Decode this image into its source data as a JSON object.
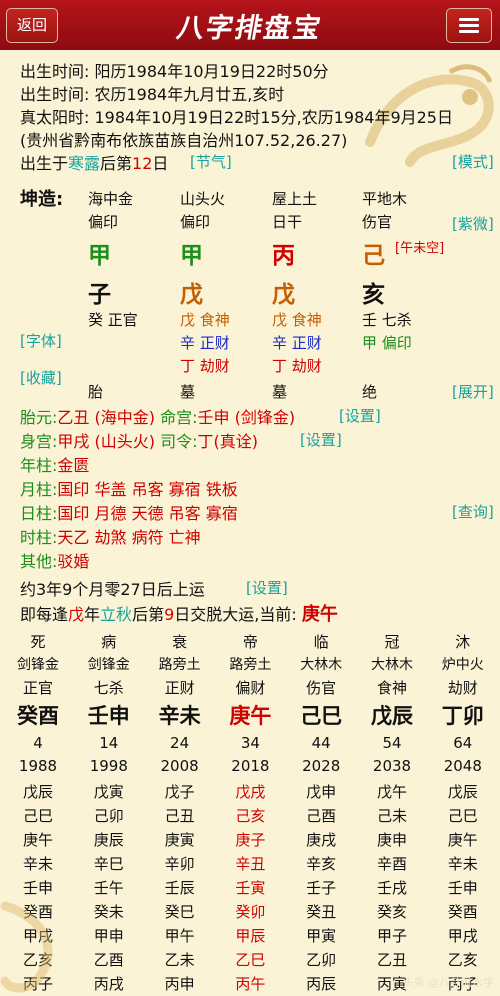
{
  "header": {
    "back_label": "返回",
    "title": "八字排盘宝"
  },
  "info": {
    "line1": "出生时间: 阳历1984年10月19日22时50分",
    "line2": "出生时间: 农历1984年九月廿五,亥时",
    "line3": "真太阳时: 1984年10月19日22时15分,农历1984年9月25日",
    "line4": "(贵州省黔南布依族苗族自治州107.52,26.27)",
    "birth_prefix": "出生于",
    "birth_term": "寒露",
    "birth_mid": "后第",
    "birth_day": "12",
    "birth_suffix": "日",
    "jieqi_link": "[节气]",
    "mode_link": "[模式]"
  },
  "chart": {
    "kunzao": "坤造:",
    "nayin": [
      "海中金",
      "山头火",
      "屋上土",
      "平地木"
    ],
    "shishen": [
      "偏印",
      "偏印",
      "日干",
      "伤官"
    ],
    "gan": [
      "甲",
      "甲",
      "丙",
      "己"
    ],
    "kongwang": "[午未空]",
    "zhi": [
      "子",
      "戊",
      "戊",
      "亥"
    ],
    "hidden": [
      [
        {
          "text": "癸 正官",
          "color": "black"
        }
      ],
      [
        {
          "text": "戊 食神",
          "color": "orange"
        },
        {
          "text": "辛 正财",
          "color": "blue"
        },
        {
          "text": "丁 劫财",
          "color": "red"
        }
      ],
      [
        {
          "text": "戊 食神",
          "color": "orange"
        },
        {
          "text": "辛 正财",
          "color": "blue"
        },
        {
          "text": "丁 劫财",
          "color": "red"
        }
      ],
      [
        {
          "text": "壬 七杀",
          "color": "black"
        },
        {
          "text": "甲 偏印",
          "color": "green"
        }
      ]
    ],
    "zhangsheng": [
      "胎",
      "墓",
      "墓",
      "绝"
    ],
    "ziwei_link": "[紫微]",
    "font_link": "[字体]",
    "collect_link": "[收藏]",
    "expand_link": "[展开]",
    "query_link": "[查询]"
  },
  "extra": {
    "taiyuan_label": "胎元:",
    "taiyuan_val": "乙丑 (海中金)",
    "minggong_label": "命宫:",
    "minggong_val": "壬申 (剑锋金)",
    "set1": "[设置]",
    "shengong_label": "身宫:",
    "shengong_val": "甲戌 (山头火)",
    "siling_label": "司令:",
    "siling_val": "丁(真诠)",
    "set2": "[设置]",
    "nianzhu_label": "年柱:",
    "nianzhu_val": "金匮",
    "yuezhu_label": "月柱:",
    "yuezhu_val": "国印 华盖 吊客 寡宿 铁板",
    "rizhu_label": "日柱:",
    "rizhu_val": "国印 月德 天德 吊客 寡宿",
    "shizhu_label": "时柱:",
    "shizhu_val": "天乙 劫煞 病符 亡神",
    "other_label": "其他:",
    "other_val": "驳婚"
  },
  "yun": {
    "start": "约3年9个月零27日后上运",
    "start_set": "[设置]",
    "jiao_prefix": "即每逢",
    "jiao_gan": "戊",
    "jiao_mid1": "年",
    "jiao_term": "立秋",
    "jiao_mid2": "后第",
    "jiao_day": "9",
    "jiao_mid3": "日交脱大运,当前: ",
    "jiao_current": "庚午"
  },
  "dayun": {
    "zhangsheng": [
      "死",
      "病",
      "衰",
      "帝",
      "临",
      "冠",
      "沐"
    ],
    "nayin": [
      "剑锋金",
      "剑锋金",
      "路旁土",
      "路旁土",
      "大林木",
      "大林木",
      "炉中火"
    ],
    "shishen": [
      "正官",
      "七杀",
      "正财",
      "偏财",
      "伤官",
      "食神",
      "劫财"
    ],
    "ganzhi": [
      "癸酉",
      "壬申",
      "辛未",
      "庚午",
      "己巳",
      "戊辰",
      "丁卯"
    ],
    "age": [
      "4",
      "14",
      "24",
      "34",
      "44",
      "54",
      "64"
    ],
    "year": [
      "1988",
      "1998",
      "2008",
      "2018",
      "2028",
      "2038",
      "2048"
    ],
    "liunian": [
      [
        "戊辰",
        "戊寅",
        "戊子",
        "戊戌",
        "戊申",
        "戊午",
        "戊辰"
      ],
      [
        "己巳",
        "己卯",
        "己丑",
        "己亥",
        "己酉",
        "己未",
        "己巳"
      ],
      [
        "庚午",
        "庚辰",
        "庚寅",
        "庚子",
        "庚戌",
        "庚申",
        "庚午"
      ],
      [
        "辛未",
        "辛巳",
        "辛卯",
        "辛丑",
        "辛亥",
        "辛酉",
        "辛未"
      ],
      [
        "壬申",
        "壬午",
        "壬辰",
        "壬寅",
        "壬子",
        "壬戌",
        "壬申"
      ],
      [
        "癸酉",
        "癸未",
        "癸巳",
        "癸卯",
        "癸丑",
        "癸亥",
        "癸酉"
      ],
      [
        "甲戌",
        "甲申",
        "甲午",
        "甲辰",
        "甲寅",
        "甲子",
        "甲戌"
      ],
      [
        "乙亥",
        "乙酉",
        "乙未",
        "乙巳",
        "乙卯",
        "乙丑",
        "乙亥"
      ],
      [
        "丙子",
        "丙戌",
        "丙申",
        "丙午",
        "丙辰",
        "丙寅",
        "丙子"
      ]
    ]
  },
  "watermark": "头条 @八卦风水学"
}
